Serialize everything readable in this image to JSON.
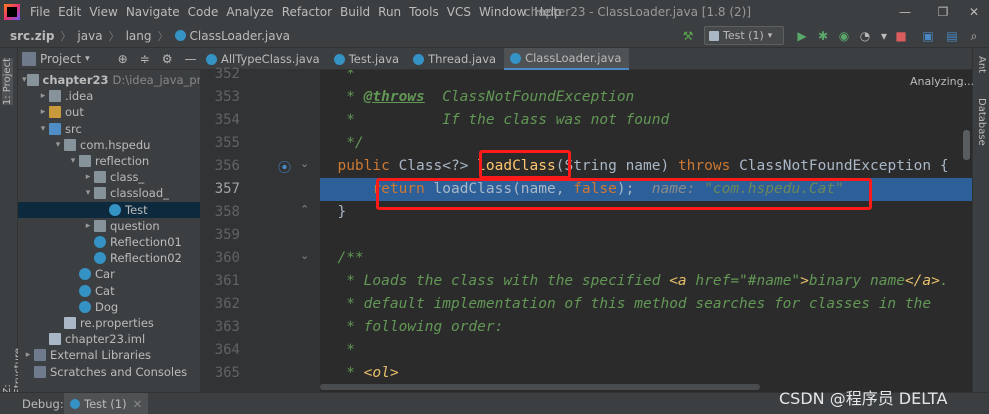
{
  "menu": {
    "items": [
      "File",
      "Edit",
      "View",
      "Navigate",
      "Code",
      "Analyze",
      "Refactor",
      "Build",
      "Run",
      "Tools",
      "VCS",
      "Window",
      "Help"
    ],
    "window_title": "chapter23 - ClassLoader.java [1.8 (2)]"
  },
  "breadcrumbs": [
    "src.zip",
    "java",
    "lang",
    "ClassLoader.java"
  ],
  "run_config": {
    "label": "Test (1)"
  },
  "project_panel": {
    "title": "Project",
    "tree": [
      {
        "label": "chapter23",
        "extra": "D:\\idea_java_proje",
        "level": 0,
        "arrow": "▾",
        "icon": "folder",
        "bold": true
      },
      {
        "label": ".idea",
        "level": 1,
        "arrow": "▸",
        "icon": "folder"
      },
      {
        "label": "out",
        "level": 1,
        "arrow": "▸",
        "icon": "folder-o"
      },
      {
        "label": "src",
        "level": 1,
        "arrow": "▾",
        "icon": "folder-b"
      },
      {
        "label": "com.hspedu",
        "level": 2,
        "arrow": "▾",
        "icon": "pkg"
      },
      {
        "label": "reflection",
        "level": 3,
        "arrow": "▾",
        "icon": "pkg"
      },
      {
        "label": "class_",
        "level": 4,
        "arrow": "▸",
        "icon": "pkg"
      },
      {
        "label": "classload_",
        "level": 4,
        "arrow": "▾",
        "icon": "pkg"
      },
      {
        "label": "Test",
        "level": 5,
        "arrow": "",
        "icon": "class",
        "selected": true
      },
      {
        "label": "question",
        "level": 4,
        "arrow": "▸",
        "icon": "pkg"
      },
      {
        "label": "Reflection01",
        "level": 4,
        "arrow": "",
        "icon": "class"
      },
      {
        "label": "Reflection02",
        "level": 4,
        "arrow": "",
        "icon": "class"
      },
      {
        "label": "Car",
        "level": 3,
        "arrow": "",
        "icon": "class"
      },
      {
        "label": "Cat",
        "level": 3,
        "arrow": "",
        "icon": "class"
      },
      {
        "label": "Dog",
        "level": 3,
        "arrow": "",
        "icon": "class"
      },
      {
        "label": "re.properties",
        "level": 2,
        "arrow": "",
        "icon": "file"
      },
      {
        "label": "chapter23.iml",
        "level": 1,
        "arrow": "",
        "icon": "file"
      },
      {
        "label": "External Libraries",
        "level": 0,
        "arrow": "▸",
        "icon": "lib"
      },
      {
        "label": "Scratches and Consoles",
        "level": 0,
        "arrow": "",
        "icon": "lib"
      }
    ]
  },
  "side_labels": {
    "project": "1: Project",
    "structure": "Z: Structure",
    "ant": "Ant",
    "database": "Database"
  },
  "editor_tabs": [
    {
      "label": "AllTypeClass.java",
      "active": false
    },
    {
      "label": "Test.java",
      "active": false
    },
    {
      "label": "Thread.java",
      "active": false
    },
    {
      "label": "ClassLoader.java",
      "active": true
    }
  ],
  "editor": {
    "status": "Analyzing...",
    "line_numbers": [
      "352",
      "353",
      "354",
      "355",
      "356",
      "357",
      "358",
      "359",
      "360",
      "361",
      "362",
      "363",
      "364",
      "365"
    ],
    "lines": {
      "l352": "   *",
      "l353_pre": "   * ",
      "l353_tag": "@throws",
      "l353_post": "  ClassNotFoundException",
      "l354": "   *          If the class was not found",
      "l355": "   */",
      "l356_kw": "  public ",
      "l356_type": "Class<?> ",
      "l356_fn": "loadClass",
      "l356_args": "(String name) ",
      "l356_kw2": "throws ",
      "l356_rest": "ClassNotFoundException {",
      "l357_kw": "      return ",
      "l357_call": "loadClass(name, ",
      "l357_false": "false",
      "l357_end": ");",
      "l357_inlay_name": "  name: ",
      "l357_inlay_val": "\"com.hspedu.Cat\"",
      "l358": "  }",
      "l359": "",
      "l360": "  /**",
      "l361_pre": "   * Loads the class with the specified ",
      "l361_a_open": "<a ",
      "l361_href": "href=\"#name\"",
      "l361_gt": ">",
      "l361_text": "binary name",
      "l361_a_close": "</a>",
      "l361_end": ".",
      "l362": "   * default implementation of this method searches for classes in the",
      "l363": "   * following order:",
      "l364": "   *",
      "l365_pre": "   * ",
      "l365_tag": "<ol>"
    }
  },
  "bottom_bar": {
    "debug_label": "Debug:",
    "debug_tab": "Test (1)"
  },
  "watermark": "CSDN @程序员 DELTA"
}
